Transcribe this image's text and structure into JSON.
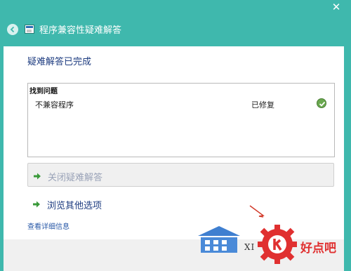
{
  "window": {
    "title": "程序兼容性疑难解答",
    "close_glyph": "✕"
  },
  "content": {
    "heading": "疑难解答已完成",
    "results_header": "找到问题",
    "results": [
      {
        "name": "不兼容程序",
        "status": "已修复"
      }
    ],
    "actions": [
      {
        "label": "关闭疑难解答",
        "enabled": false
      },
      {
        "label": "浏览其他选项",
        "enabled": true
      }
    ],
    "details_link": "查看详细信息"
  },
  "watermark": {
    "brand_text": "好点吧",
    "site_fragment": "XI"
  },
  "colors": {
    "window_bg": "#3fb8ad",
    "arrow_green": "#3a9a3a",
    "check_green": "#6aa84f",
    "heading_blue": "#1e3c80"
  }
}
